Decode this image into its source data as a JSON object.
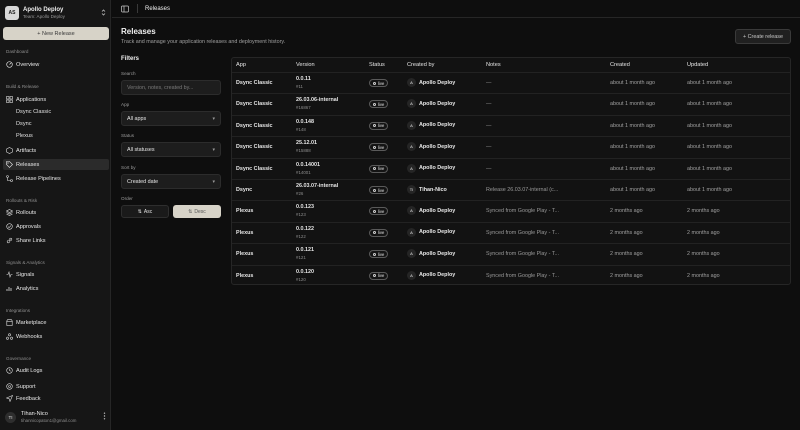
{
  "team": {
    "avatar": "AS",
    "name": "Apollo Deploy",
    "subtitle": "Team: Apollo Deploy"
  },
  "sidebar": {
    "new_release_label": "+ New Release",
    "sections": {
      "dashboard": "Dashboard",
      "build_release": "Build & Release",
      "rollouts_risk": "Rollouts & Risk",
      "signals_analytics": "Signals & Analytics",
      "integrations": "Integrations",
      "governance": "Governance"
    },
    "items": {
      "overview": "Overview",
      "applications": "Applications",
      "app_dsync_classic": "Dsync Classic",
      "app_dsync": "Dsync",
      "app_plexus": "Plexus",
      "artifacts": "Artifacts",
      "releases": "Releases",
      "release_pipelines": "Release Pipelines",
      "rollouts": "Rollouts",
      "approvals": "Approvals",
      "share_links": "Share Links",
      "signals": "Signals",
      "analytics": "Analytics",
      "marketplace": "Marketplace",
      "webhooks": "Webhooks",
      "audit_logs": "Audit Logs",
      "support": "Support",
      "feedback": "Feedback"
    }
  },
  "user": {
    "initials": "TI",
    "name": "Tihan-Nico",
    "email": "tihannicopaton1@gmail.com"
  },
  "topbar": {
    "title": "Releases"
  },
  "page": {
    "title": "Releases",
    "subtitle": "Track and manage your application releases and deployment history.",
    "create_label": "+ Create release"
  },
  "filters": {
    "title": "Filters",
    "search_label": "Search",
    "search_placeholder": "Version, notes, created by...",
    "app_label": "App",
    "app_value": "All apps",
    "status_label": "Status",
    "status_value": "All statuses",
    "sort_label": "Sort by",
    "sort_value": "Created date",
    "order_label": "Order",
    "asc_label": "Asc",
    "desc_label": "Desc"
  },
  "table": {
    "headers": {
      "app": "App",
      "version": "Version",
      "status": "Status",
      "created_by": "Created by",
      "notes": "Notes",
      "created": "Created",
      "updated": "Updated"
    },
    "rows": [
      {
        "app": "Dsync Classic",
        "version": "0.0.11",
        "build": "#11",
        "status": "live",
        "creator_icon": "A",
        "creator": "Apollo Deploy",
        "notes": "—",
        "created": "about 1 month ago",
        "updated": "about 1 month ago"
      },
      {
        "app": "Dsync Classic",
        "version": "26.03.06-internal",
        "build": "#16867",
        "status": "live",
        "creator_icon": "A",
        "creator": "Apollo Deploy",
        "notes": "—",
        "created": "about 1 month ago",
        "updated": "about 1 month ago"
      },
      {
        "app": "Dsync Classic",
        "version": "0.0.148",
        "build": "#148",
        "status": "live",
        "creator_icon": "A",
        "creator": "Apollo Deploy",
        "notes": "—",
        "created": "about 1 month ago",
        "updated": "about 1 month ago"
      },
      {
        "app": "Dsync Classic",
        "version": "25.12.01",
        "build": "#15888",
        "status": "live",
        "creator_icon": "A",
        "creator": "Apollo Deploy",
        "notes": "—",
        "created": "about 1 month ago",
        "updated": "about 1 month ago"
      },
      {
        "app": "Dsync Classic",
        "version": "0.0.14001",
        "build": "#14001",
        "status": "live",
        "creator_icon": "A",
        "creator": "Apollo Deploy",
        "notes": "—",
        "created": "about 1 month ago",
        "updated": "about 1 month ago"
      },
      {
        "app": "Dsync",
        "version": "26.03.07-internal",
        "build": "#26",
        "status": "live",
        "creator_icon": "TI",
        "creator": "Tihan-Nico",
        "notes": "Release 26.03.07-internal (c...",
        "created": "about 1 month ago",
        "updated": "about 1 month ago"
      },
      {
        "app": "Plexus",
        "version": "0.0.123",
        "build": "#123",
        "status": "live",
        "creator_icon": "A",
        "creator": "Apollo Deploy",
        "notes": "Synced from Google Play - T...",
        "created": "2 months ago",
        "updated": "2 months ago"
      },
      {
        "app": "Plexus",
        "version": "0.0.122",
        "build": "#122",
        "status": "live",
        "creator_icon": "A",
        "creator": "Apollo Deploy",
        "notes": "Synced from Google Play - T...",
        "created": "2 months ago",
        "updated": "2 months ago"
      },
      {
        "app": "Plexus",
        "version": "0.0.121",
        "build": "#121",
        "status": "live",
        "creator_icon": "A",
        "creator": "Apollo Deploy",
        "notes": "Synced from Google Play - T...",
        "created": "2 months ago",
        "updated": "2 months ago"
      },
      {
        "app": "Plexus",
        "version": "0.0.120",
        "build": "#120",
        "status": "live",
        "creator_icon": "A",
        "creator": "Apollo Deploy",
        "notes": "Synced from Google Play - T...",
        "created": "2 months ago",
        "updated": "2 months ago"
      }
    ]
  },
  "colors": {
    "accent_button": "#d7d3c8",
    "background": "#0e0e0e",
    "sidebar": "#161616"
  }
}
